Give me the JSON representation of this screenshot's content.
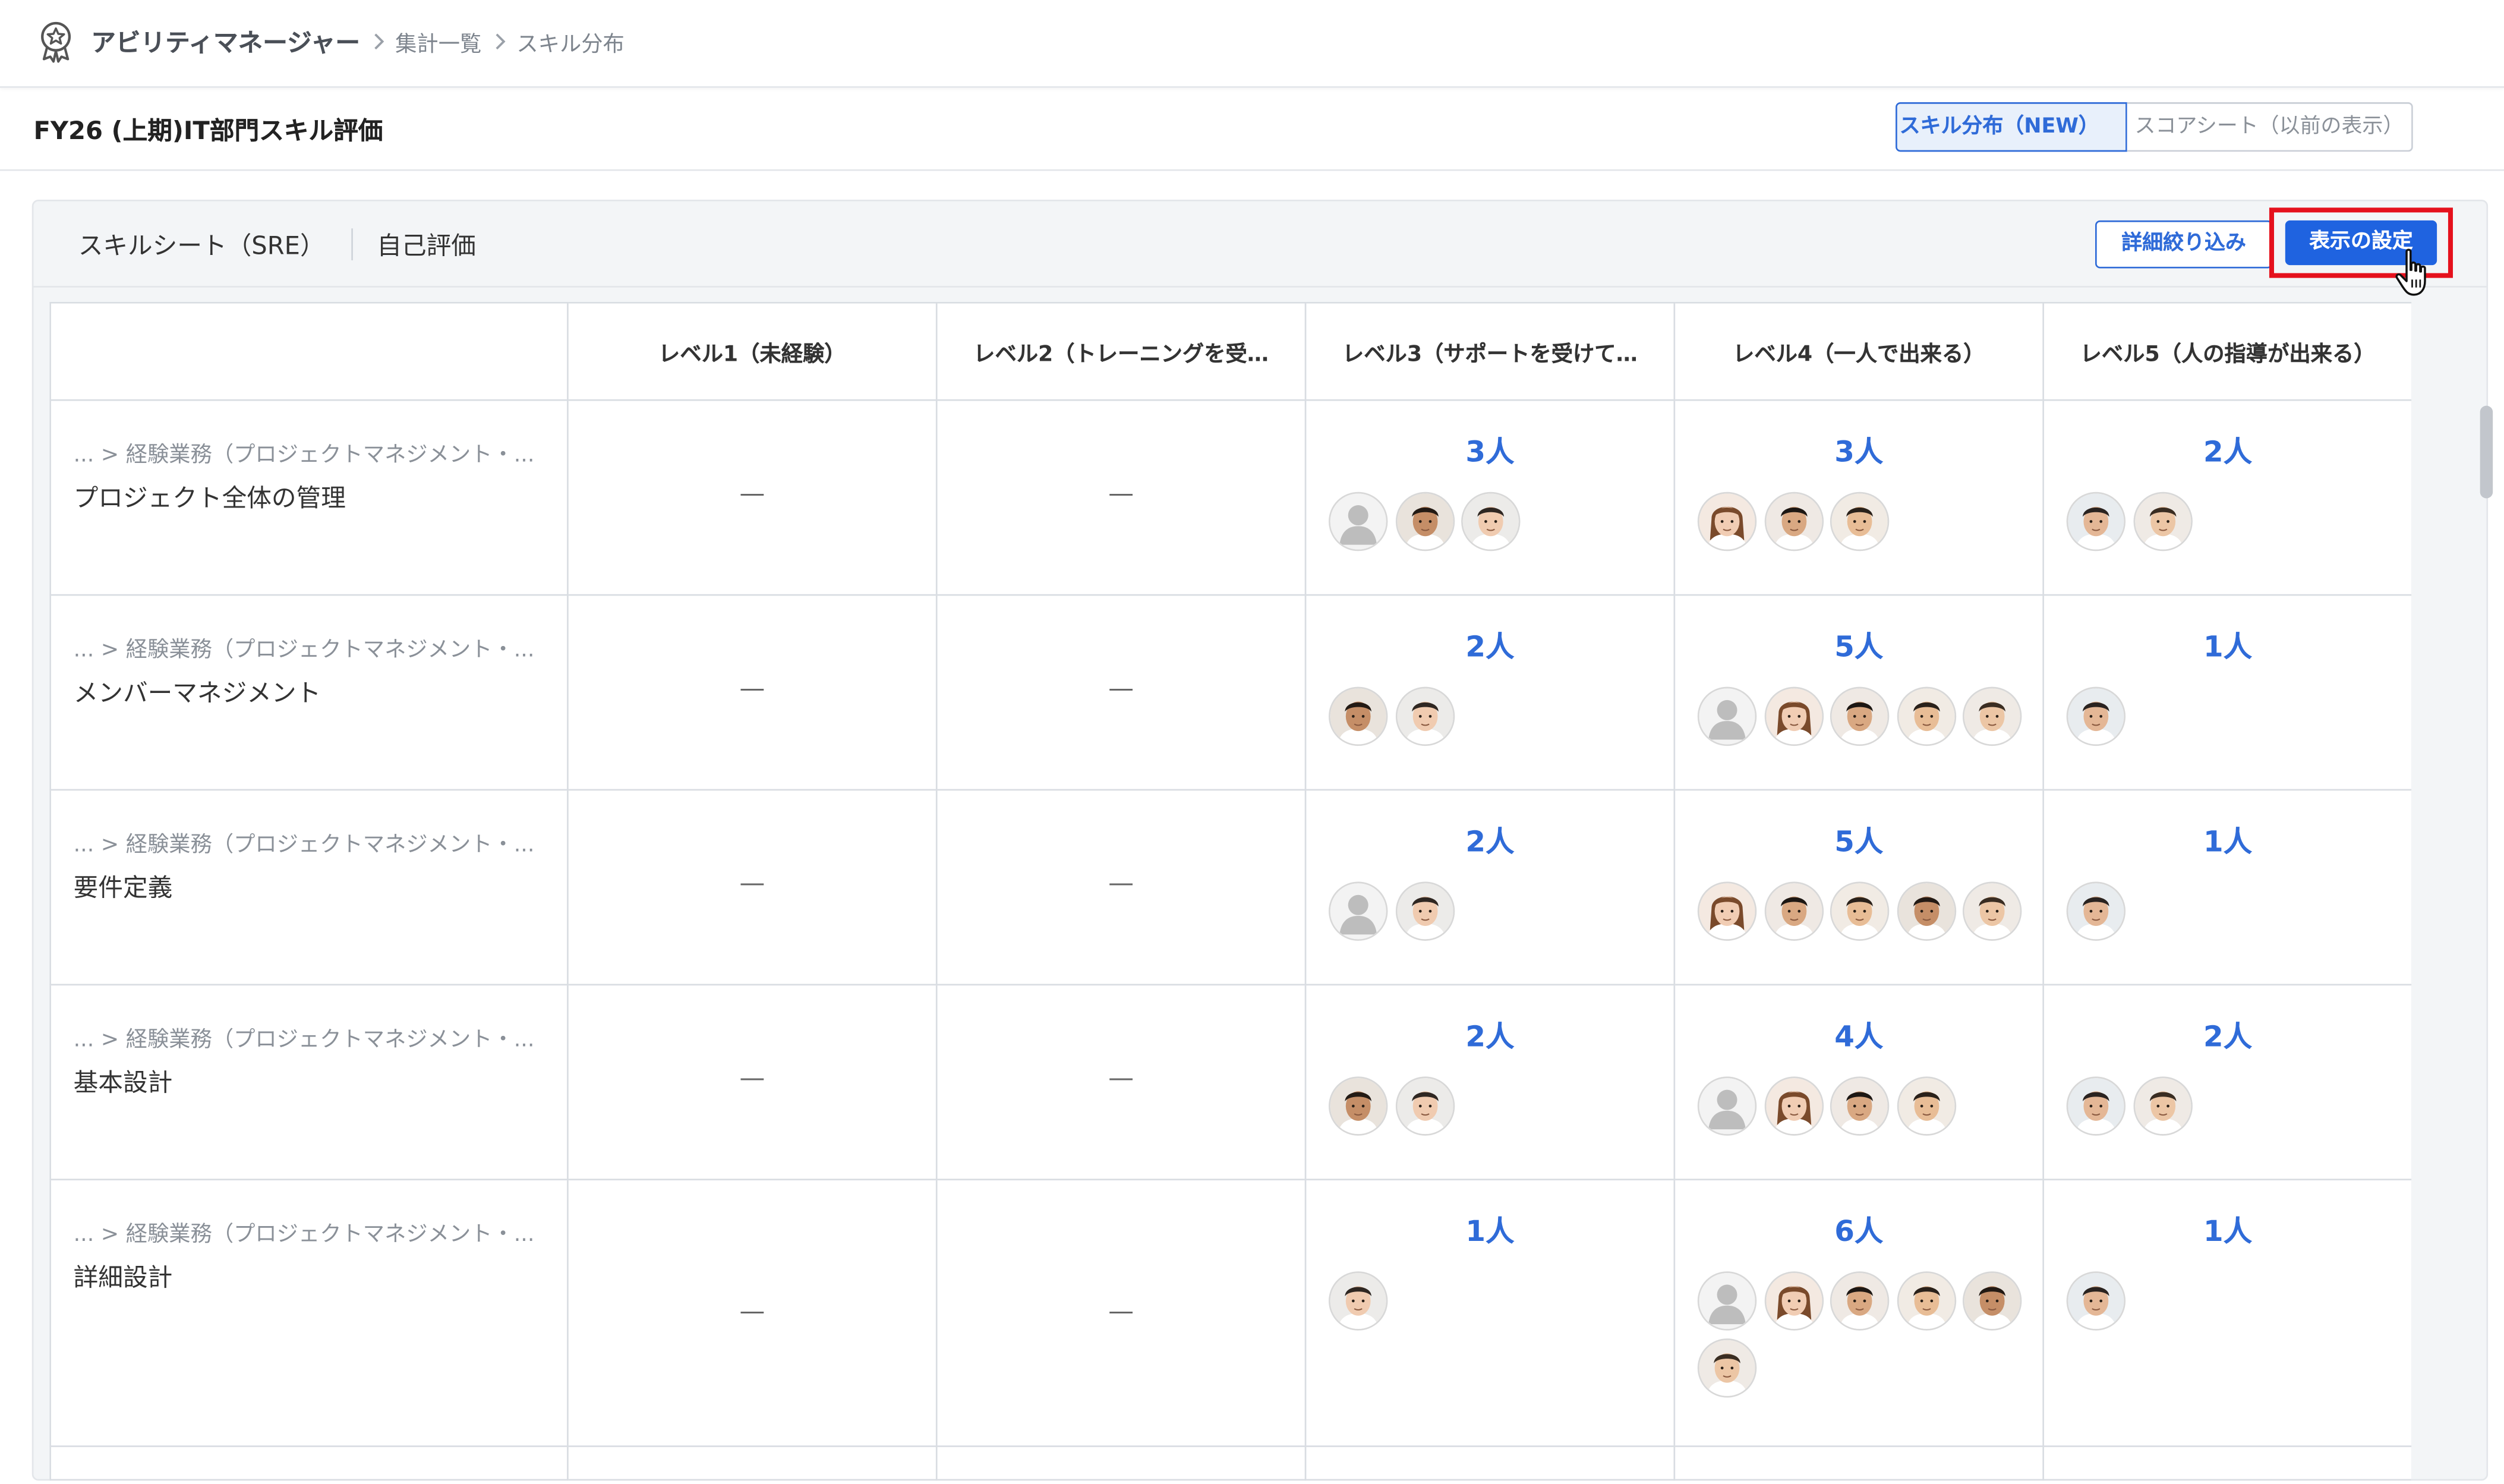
{
  "breadcrumb": {
    "app_icon": "award-badge-icon",
    "app_name": "アビリティマネージャー",
    "items": [
      "集計一覧",
      "スキル分布"
    ]
  },
  "title": "FY26 (上期)IT部門スキル評価",
  "view_toggle": {
    "active": "スキル分布（NEW）",
    "other": "スコアシート（以前の表示）"
  },
  "panel": {
    "sheet_name": "スキルシート（SRE）",
    "eval_type": "自己評価",
    "filter_button": "詳細絞り込み",
    "display_button": "表示の設定",
    "highlight_color": "#e5111d"
  },
  "table": {
    "columns": [
      "",
      "レベル1（未経験）",
      "レベル2（トレーニングを受…",
      "レベル3（サポートを受けて…",
      "レベル4（一人で出来る）",
      "レベル5（人の指導が出来る）"
    ],
    "rows": [
      {
        "path": "... > 経験業務（プロジェクトマネジメント・...",
        "name": "プロジェクト全体の管理",
        "l1": "—",
        "l2": "—",
        "l3": {
          "count": "3人",
          "avatars": [
            "g",
            "m1",
            "m5"
          ]
        },
        "l4": {
          "count": "3人",
          "avatars": [
            "f1",
            "m2",
            "m3"
          ]
        },
        "l5": {
          "count": "2人",
          "avatars": [
            "m4",
            "m6"
          ]
        }
      },
      {
        "path": "... > 経験業務（プロジェクトマネジメント・...",
        "name": "メンバーマネジメント",
        "l1": "—",
        "l2": "—",
        "l3": {
          "count": "2人",
          "avatars": [
            "m1",
            "m5"
          ]
        },
        "l4": {
          "count": "5人",
          "avatars": [
            "g",
            "f1",
            "m2",
            "m3",
            "m6"
          ]
        },
        "l5": {
          "count": "1人",
          "avatars": [
            "m4"
          ]
        }
      },
      {
        "path": "... > 経験業務（プロジェクトマネジメント・...",
        "name": "要件定義",
        "l1": "—",
        "l2": "—",
        "l3": {
          "count": "2人",
          "avatars": [
            "g",
            "m5"
          ]
        },
        "l4": {
          "count": "5人",
          "avatars": [
            "f1",
            "m2",
            "m3",
            "m1",
            "m6"
          ]
        },
        "l5": {
          "count": "1人",
          "avatars": [
            "m4"
          ]
        }
      },
      {
        "path": "... > 経験業務（プロジェクトマネジメント・...",
        "name": "基本設計",
        "l1": "—",
        "l2": "—",
        "l3": {
          "count": "2人",
          "avatars": [
            "m1",
            "m5"
          ]
        },
        "l4": {
          "count": "4人",
          "avatars": [
            "g",
            "f1",
            "m2",
            "m3"
          ]
        },
        "l5": {
          "count": "2人",
          "avatars": [
            "m4",
            "m6"
          ]
        }
      },
      {
        "path": "... > 経験業務（プロジェクトマネジメント・...",
        "name": "詳細設計",
        "l1": "—",
        "l2": "—",
        "l3": {
          "count": "1人",
          "avatars": [
            "m5"
          ]
        },
        "l4": {
          "count": "6人",
          "avatars": [
            "g",
            "f1",
            "m2",
            "m3",
            "m1",
            "m6"
          ]
        },
        "l5": {
          "count": "1人",
          "avatars": [
            "m4"
          ]
        }
      }
    ]
  },
  "accent_color": "#2f6bd8"
}
